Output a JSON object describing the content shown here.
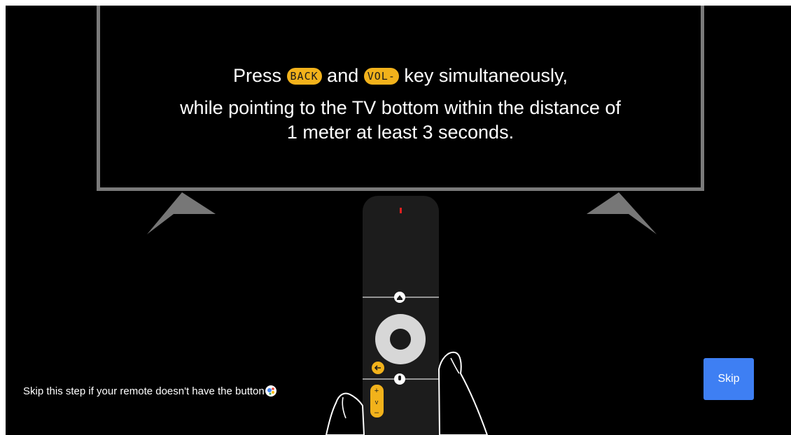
{
  "instruction": {
    "part_press": "Press",
    "key_back": "BACK",
    "part_and": "and",
    "key_vol": "VOL-",
    "part_rest": "key simultaneously,",
    "line2": "while pointing to the TV bottom within the distance of",
    "line3": "1 meter at least 3 seconds."
  },
  "footer": {
    "skip_note": "Skip this step if your remote doesn't have the button",
    "note_icon": "google-assistant-icon"
  },
  "skip_button": {
    "label": "Skip"
  },
  "remote": {
    "volume_plus": "+",
    "volume_minus": "–",
    "volume_v": "v"
  },
  "colors": {
    "background": "#000000",
    "tv_frame": "#7a7a7a",
    "key_highlight": "#f2b21b",
    "skip_button": "#3e7ff3"
  }
}
